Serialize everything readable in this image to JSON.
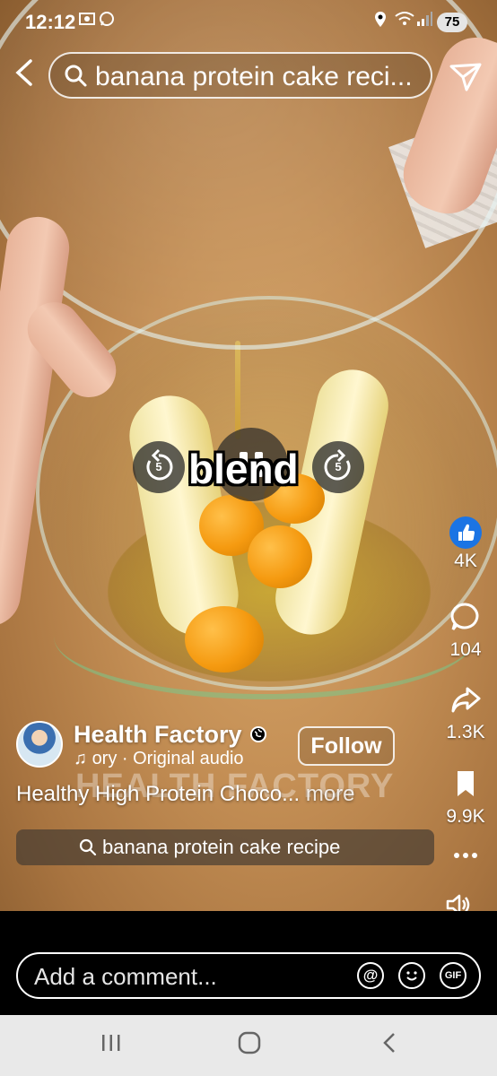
{
  "status": {
    "time": "12:12",
    "battery": "75"
  },
  "search": {
    "query": "banana protein cake reci..."
  },
  "video": {
    "caption": "blend",
    "replay_back_label": "5",
    "replay_fwd_label": "5",
    "watermark": "HEALTH FACTORY"
  },
  "actions": {
    "likes": "4K",
    "comments": "104",
    "shares": "1.3K",
    "saves": "9.9K"
  },
  "post": {
    "author": "Health Factory",
    "follow_label": "Follow",
    "audio": "ory · Original audio",
    "description": "Healthy High Protein Choco...",
    "more_label": " more",
    "related_search": "banana protein cake recipe"
  },
  "comment": {
    "placeholder": "Add a comment...",
    "gif_label": "GIF"
  },
  "colors": {
    "like_blue": "#1b74e4",
    "nav_bg": "#e9e9e9"
  }
}
